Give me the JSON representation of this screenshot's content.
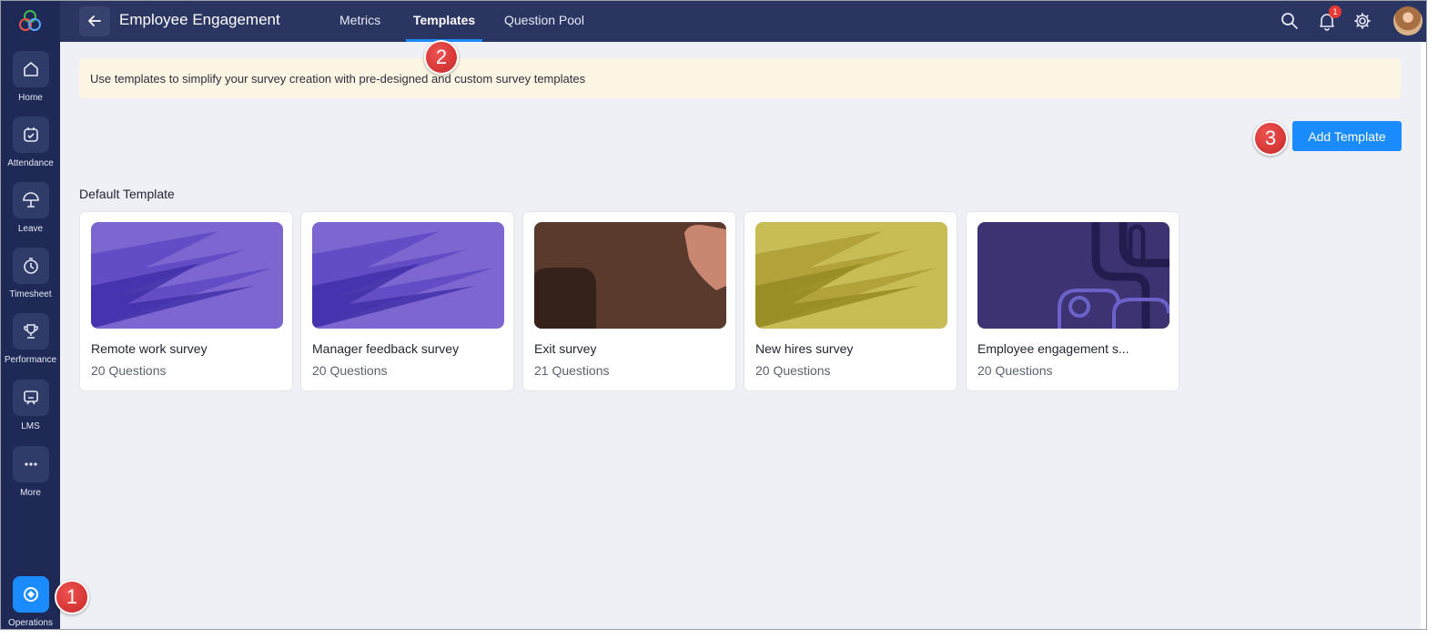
{
  "sidebar": {
    "logo_icon": "app-logo-icon",
    "items": [
      {
        "label": "Home",
        "icon": "home-icon"
      },
      {
        "label": "Attendance",
        "icon": "calendar-check-icon"
      },
      {
        "label": "Leave",
        "icon": "umbrella-icon"
      },
      {
        "label": "Timesheet",
        "icon": "timer-icon"
      },
      {
        "label": "Performance",
        "icon": "trophy-icon"
      },
      {
        "label": "LMS",
        "icon": "lms-board-icon"
      },
      {
        "label": "More",
        "icon": "more-dots-icon"
      }
    ],
    "operations": {
      "label": "Operations",
      "icon": "operations-icon",
      "active_color": "#1a8cff"
    }
  },
  "header": {
    "title": "Employee Engagement",
    "tabs": [
      {
        "label": "Metrics",
        "active": false
      },
      {
        "label": "Templates",
        "active": true
      },
      {
        "label": "Question Pool",
        "active": false
      }
    ],
    "notification_count": "1",
    "icons": [
      "back-arrow-icon",
      "search-icon",
      "bell-icon",
      "gear-icon",
      "avatar"
    ]
  },
  "banner": {
    "text": "Use templates to simplify your survey creation with pre-designed and custom survey templates",
    "background": "#fdf5e4"
  },
  "toolbar": {
    "add_template_label": "Add Template",
    "accent": "#1a8cff"
  },
  "section": {
    "title": "Default Template"
  },
  "templates": [
    {
      "title": "Remote work survey",
      "questions": "20 Questions",
      "theme": "purple"
    },
    {
      "title": "Manager feedback survey",
      "questions": "20 Questions",
      "theme": "purple"
    },
    {
      "title": "Exit survey",
      "questions": "21 Questions",
      "theme": "brown"
    },
    {
      "title": "New hires survey",
      "questions": "20 Questions",
      "theme": "olive"
    },
    {
      "title": "Employee engagement s...",
      "questions": "20 Questions",
      "theme": "navy"
    }
  ],
  "markers": [
    "1",
    "2",
    "3"
  ]
}
